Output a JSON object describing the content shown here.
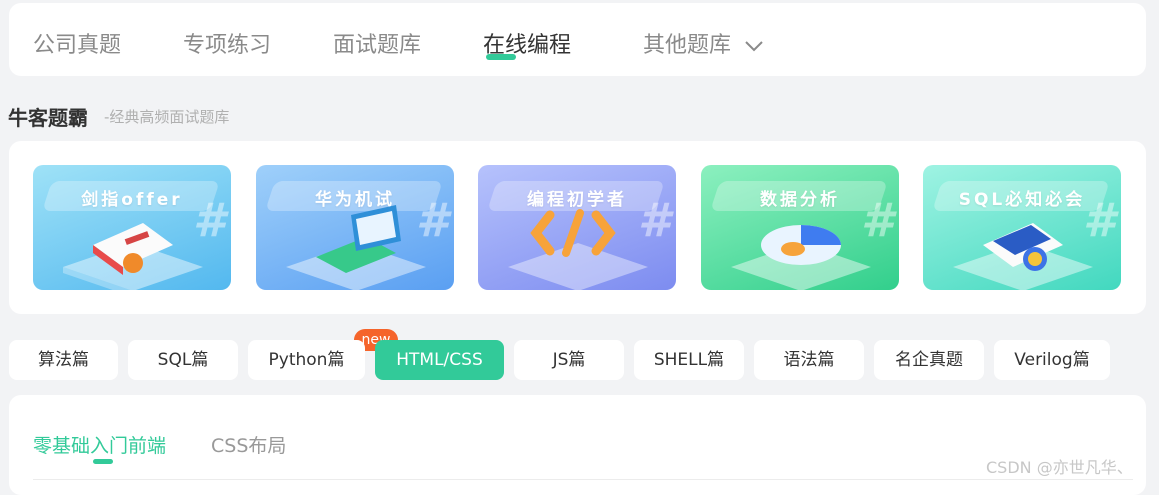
{
  "topnav": {
    "tabs": [
      {
        "label": "公司真题"
      },
      {
        "label": "专项练习"
      },
      {
        "label": "面试题库"
      },
      {
        "label": "在线编程"
      },
      {
        "label": "其他题库"
      }
    ],
    "active_tab": "在线编程"
  },
  "section": {
    "title": "牛客题霸",
    "subtitle": "-经典高频面试题库"
  },
  "cards": [
    {
      "label": "剑指offer",
      "color_from": "#7fd6f3",
      "color_to": "#4fb7ee"
    },
    {
      "label": "华为机试",
      "color_from": "#86c4f7",
      "color_to": "#5ea4f3"
    },
    {
      "label": "编程初学者",
      "color_from": "#a9b8fb",
      "color_to": "#8393f3"
    },
    {
      "label": "数据分析",
      "color_from": "#6ee6b0",
      "color_to": "#35cf8f"
    },
    {
      "label": "SQL必知必会",
      "color_from": "#7eebd6",
      "color_to": "#3fd6bd"
    }
  ],
  "chips": {
    "items": [
      {
        "label": "算法篇"
      },
      {
        "label": "SQL篇"
      },
      {
        "label": "Python篇"
      },
      {
        "label": "HTML/CSS"
      },
      {
        "label": "JS篇"
      },
      {
        "label": "SHELL篇"
      },
      {
        "label": "语法篇"
      },
      {
        "label": "名企真题"
      },
      {
        "label": "Verilog篇"
      }
    ],
    "active": "HTML/CSS",
    "badge": "new"
  },
  "subtabs": {
    "items": [
      {
        "label": "零基础入门前端"
      },
      {
        "label": "CSS布局"
      }
    ],
    "active": "零基础入门前端"
  },
  "watermark": "CSDN @亦世凡华、",
  "colors": {
    "accent": "#32ca99",
    "badge": "#f5642b"
  }
}
